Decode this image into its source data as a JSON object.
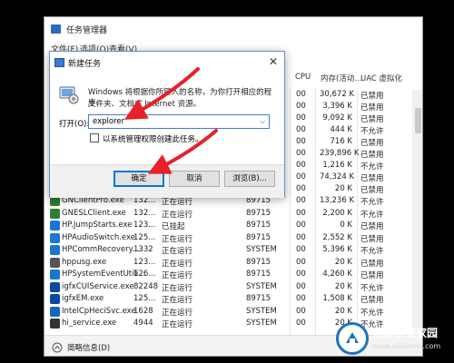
{
  "task_manager": {
    "title": "任务管理器",
    "menu": [
      "文件(F)",
      "选项(O)",
      "查看(V)"
    ],
    "columns": {
      "cpu": "CPU",
      "memory": "内存(活动...",
      "uac": "UAC 虚拟化"
    },
    "top_rows": [
      {
        "cpu": "00",
        "memory": "30,672 K",
        "uac": "已禁用"
      },
      {
        "cpu": "00",
        "memory": "3,396 K",
        "uac": "已禁用"
      },
      {
        "cpu": "00",
        "memory": "9,092 K",
        "uac": "已禁用"
      },
      {
        "cpu": "00",
        "memory": "444 K",
        "uac": "不允许"
      },
      {
        "cpu": "00",
        "memory": "716 K",
        "uac": "已禁用"
      },
      {
        "cpu": "00",
        "memory": "239,896 K",
        "uac": "已禁用"
      },
      {
        "cpu": "00",
        "memory": "1,216 K",
        "uac": "不允许"
      },
      {
        "cpu": "00",
        "memory": "74,324 K",
        "uac": "已禁用"
      },
      {
        "cpu": "00",
        "memory": "20 K",
        "uac": "已禁用"
      }
    ],
    "rows": [
      {
        "name": "GNClientPro.exe",
        "pid": "132...",
        "status": "正在运行",
        "user": "89715",
        "cpu": "00",
        "memory": "13,236 K",
        "uac": "不允许"
      },
      {
        "name": "GNESLClient.exe",
        "pid": "132...",
        "status": "正在运行",
        "user": "89715",
        "cpu": "00",
        "memory": "2,200 K",
        "uac": "不允许"
      },
      {
        "name": "HP.JumpStarts.exe",
        "pid": "123...",
        "status": "已挂起",
        "user": "89715",
        "cpu": "00",
        "memory": "0 K",
        "uac": "已禁用"
      },
      {
        "name": "HPAudioSwitch.exe",
        "pid": "125...",
        "status": "正在运行",
        "user": "89715",
        "cpu": "00",
        "memory": "2,552 K",
        "uac": "已禁用"
      },
      {
        "name": "HPCommRecovery....",
        "pid": "1332",
        "status": "正在运行",
        "user": "SYSTEM",
        "cpu": "00",
        "memory": "5,396 K",
        "uac": "不允许"
      },
      {
        "name": "hppusg.exe",
        "pid": "123...",
        "status": "正在运行",
        "user": "89715",
        "cpu": "00",
        "memory": "20 K",
        "uac": "已禁用"
      },
      {
        "name": "HPSystemEventUtili...",
        "pid": "126...",
        "status": "正在运行",
        "user": "89715",
        "cpu": "00",
        "memory": "4,260 K",
        "uac": "已禁用"
      },
      {
        "name": "igfxCUIService.exe",
        "pid": "82248",
        "status": "正在运行",
        "user": "SYSTEM",
        "cpu": "00",
        "memory": "20 K",
        "uac": "不允许"
      },
      {
        "name": "igfxEM.exe",
        "pid": "125...",
        "status": "正在运行",
        "user": "89715",
        "cpu": "00",
        "memory": "1,508 K",
        "uac": "已禁用"
      },
      {
        "name": "IntelCpHeciSvc.exe",
        "pid": "1628",
        "status": "正在运行",
        "user": "SYSTEM",
        "cpu": "00",
        "memory": "20 K",
        "uac": "不允许"
      },
      {
        "name": "hi_service.exe",
        "pid": "4944",
        "status": "正在运行",
        "user": "SYSTEM",
        "cpu": "00",
        "memory": "20 K",
        "uac": "不允许"
      }
    ],
    "footer": "简略信息(D)"
  },
  "run_dialog": {
    "title": "新建任务",
    "close": "✕",
    "description_line1": "Windows 将根据你所键入的名称，为你打开相应的程序、",
    "description_line2": "文件夹、文档或 Internet 资源。",
    "open_label": "打开(O):",
    "input_value": "explorer",
    "admin_checkbox_label": "以系统管理权限创建此任务。",
    "admin_checked": false,
    "ok_label": "确定",
    "cancel_label": "取消",
    "browse_label": "浏览(B)..."
  },
  "watermark": {
    "name": "纯净系统家园",
    "url": "www.yidaimei.com"
  },
  "colors": {
    "arrow": "#e8202a",
    "accent": "#0078d7",
    "watermark_ring": "#1e73be"
  }
}
